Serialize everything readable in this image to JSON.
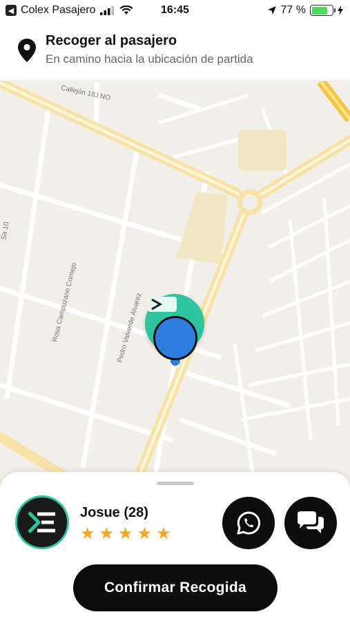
{
  "status_bar": {
    "carrier": "Colex Pasajero",
    "time": "16:45",
    "battery": "77 %",
    "battery_level": 0.77
  },
  "header": {
    "title": "Recoger al pasajero",
    "subtitle": "En camino hacia la ubicación de partida",
    "icon": "location-pin-icon"
  },
  "map": {
    "streets": [
      "Callejón 18J NO",
      "Rosa Campuzano Cornejo",
      "Pedro Valverde Álvarez",
      "Sa 10"
    ]
  },
  "driver": {
    "name": "Josue (28)",
    "rating": 5
  },
  "actions": {
    "whatsapp_icon": "whatsapp-icon",
    "chat_icon": "chat-bubbles-icon",
    "confirm_label": "Confirmar Recogida"
  },
  "colors": {
    "accent": "#2ec4a0",
    "user_marker": "#2f7de1",
    "star": "#f5a623",
    "button": "#0d0d0d"
  }
}
